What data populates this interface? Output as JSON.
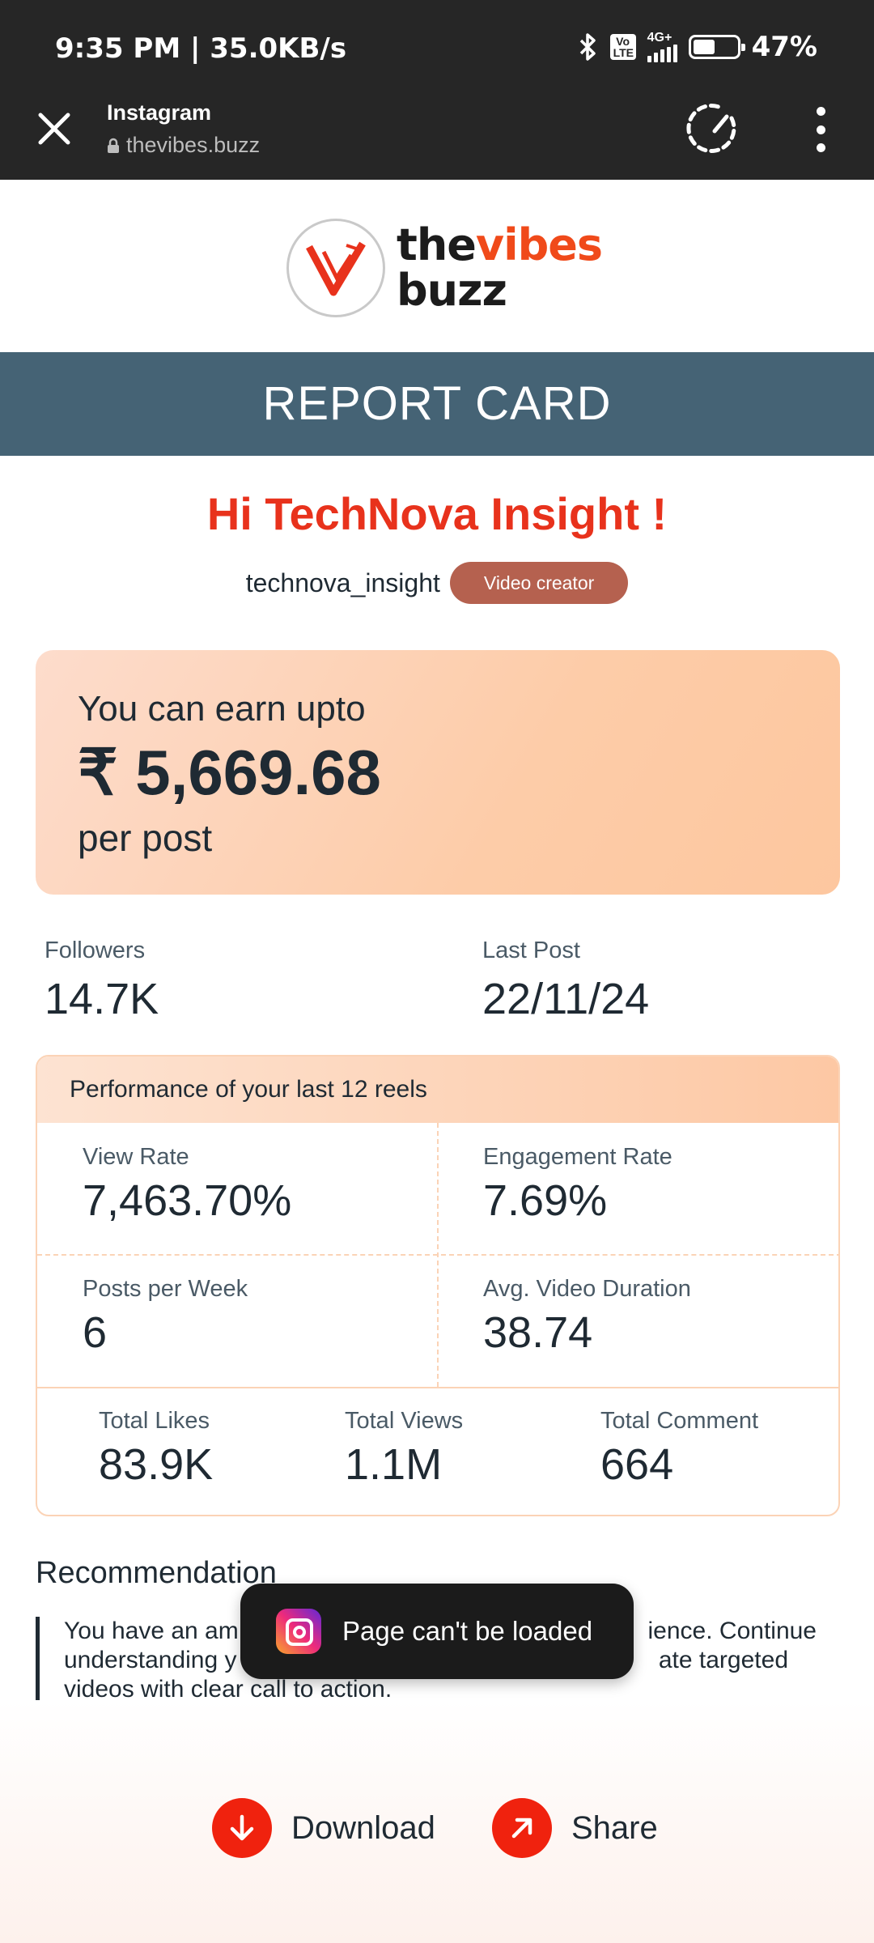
{
  "status_bar": {
    "time": "9:35 PM | 35.0KB/s",
    "volte_top": "Vo",
    "volte_bottom": "LTE",
    "network": "4G+",
    "battery": "47%",
    "battery_level": 0.47,
    "icons": [
      "bluetooth-icon",
      "signal-icon",
      "battery-icon"
    ]
  },
  "browser": {
    "title": "Instagram",
    "url": "thevibes.buzz",
    "icons": [
      "close-icon",
      "lock-icon",
      "speedometer-icon",
      "more-vert-icon"
    ]
  },
  "logo": {
    "word1": "the",
    "word2": "vibes",
    "word3": "buzz",
    "accent_color": "#f04a1a"
  },
  "banner": {
    "title": "REPORT CARD",
    "color": "#456375"
  },
  "profile": {
    "greeting": "Hi TechNova Insight !",
    "username": "technova_insight",
    "badge": "Video creator"
  },
  "earn": {
    "label": "You can earn upto",
    "value": "₹ 5,669.68",
    "unit": "per post"
  },
  "overview": {
    "followers_label": "Followers",
    "followers_value": "14.7K",
    "last_post_label": "Last Post",
    "last_post_value": "22/11/24"
  },
  "performance": {
    "heading": "Performance of your last 12 reels",
    "view_rate_label": "View Rate",
    "view_rate_value": "7,463.70%",
    "engagement_label": "Engagement Rate",
    "engagement_value": "7.69%",
    "posts_week_label": "Posts per Week",
    "posts_week_value": "6",
    "avg_duration_label": "Avg. Video Duration",
    "avg_duration_value": "38.74",
    "likes_label": "Total Likes",
    "likes_value": "83.9K",
    "views_label": "Total Views",
    "views_value": "1.1M",
    "comments_label": "Total Comment",
    "comments_value": "664"
  },
  "recommendation": {
    "title": "Recommendation",
    "line1": "You have an am",
    "line1_end": "ience. Continue",
    "line2": "understanding y",
    "line2_end": "ate targeted",
    "line3": "videos with clear call to action."
  },
  "toast": {
    "text": "Page can't be loaded",
    "icon": "instagram-icon"
  },
  "actions": {
    "download": "Download",
    "share": "Share",
    "accent": "#f0220e",
    "icons": [
      "arrow-down-icon",
      "arrow-up-right-icon"
    ]
  }
}
